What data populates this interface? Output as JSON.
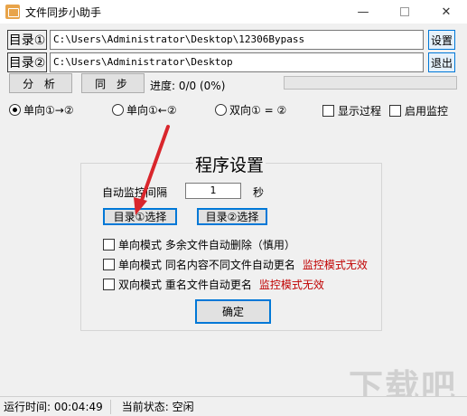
{
  "window": {
    "title": "文件同步小助手",
    "min": "—",
    "close": "✕"
  },
  "rows": [
    {
      "label": "目录①",
      "path": "C:\\Users\\Administrator\\Desktop\\12306Bypass",
      "button": "设置"
    },
    {
      "label": "目录②",
      "path": "C:\\Users\\Administrator\\Desktop",
      "button": "退出"
    }
  ],
  "toolbar": {
    "analyze": "分 析",
    "sync": "同 步",
    "progress": "进度: 0/0 (0%)",
    "progress_value": 0
  },
  "modes": [
    {
      "label": "单向①→②",
      "selected": true
    },
    {
      "label": "单向①←②",
      "selected": false
    },
    {
      "label": "双向① = ②",
      "selected": false
    }
  ],
  "options": [
    {
      "label": "显示过程",
      "checked": false
    },
    {
      "label": "启用监控",
      "checked": false
    }
  ],
  "settings": {
    "title": "程序设置",
    "interval_label": "自动监控间隔",
    "interval_value": "1",
    "interval_unit": "秒",
    "dir1_button": "目录①选择",
    "dir2_button": "目录②选择",
    "checks": [
      {
        "label": "单向模式  多余文件自动删除（慎用）",
        "warning": ""
      },
      {
        "label": "单向模式  同名内容不同文件自动更名",
        "warning": "监控模式无效"
      },
      {
        "label": "双向模式  重名文件自动更名",
        "warning": "监控模式无效"
      }
    ],
    "ok": "确定"
  },
  "status": {
    "runtime": "运行时间: 00:04:49",
    "state": "当前状态: 空闲"
  },
  "watermark": "下载吧",
  "colors": {
    "accent": "#0078d7",
    "warning": "#c00000",
    "arrow": "#d9262c"
  }
}
